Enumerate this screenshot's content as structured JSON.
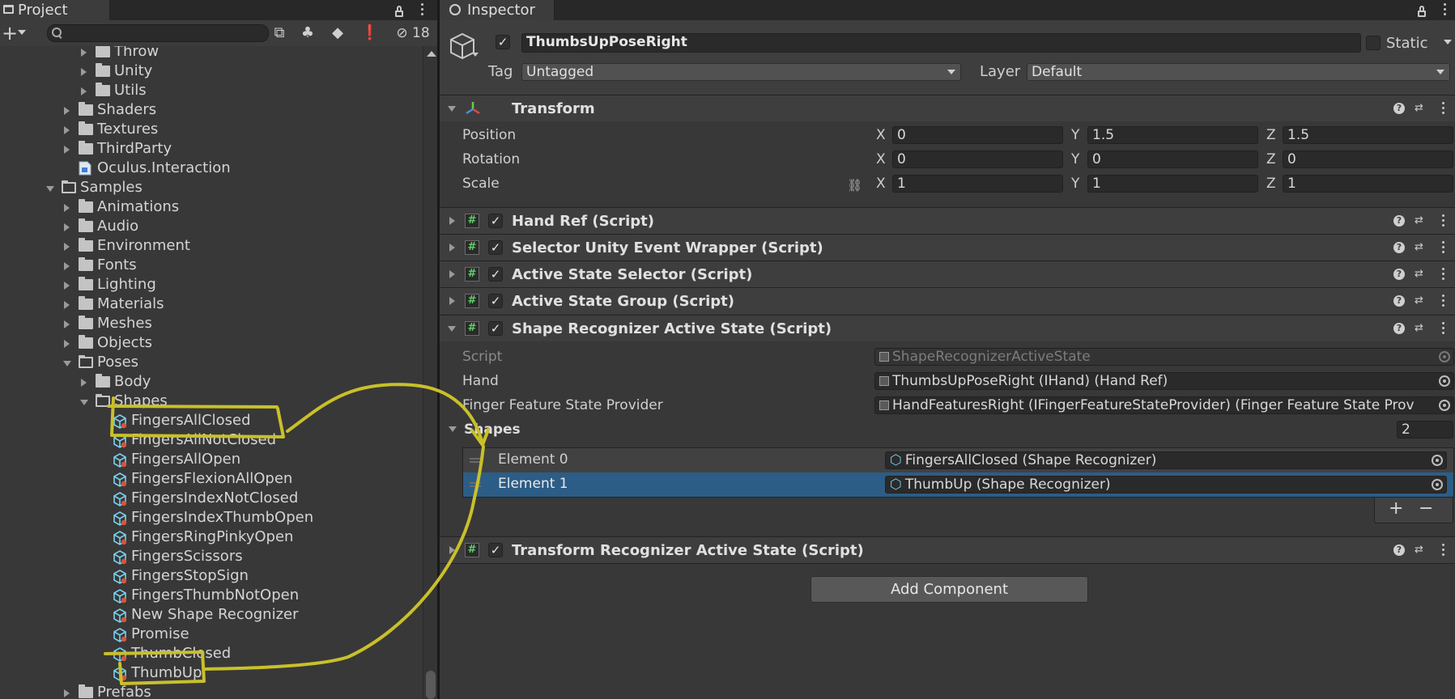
{
  "project_panel": {
    "tab_label": "Project",
    "hidden_count": "18",
    "tree": [
      {
        "label": "Throw",
        "type": "folder",
        "expanded": false,
        "depth": 4,
        "has_children": true
      },
      {
        "label": "Unity",
        "type": "folder",
        "expanded": false,
        "depth": 4,
        "has_children": true
      },
      {
        "label": "Utils",
        "type": "folder",
        "expanded": false,
        "depth": 4,
        "has_children": true
      },
      {
        "label": "Shaders",
        "type": "folder",
        "expanded": false,
        "depth": 3,
        "has_children": true
      },
      {
        "label": "Textures",
        "type": "folder",
        "expanded": false,
        "depth": 3,
        "has_children": true
      },
      {
        "label": "ThirdParty",
        "type": "folder",
        "expanded": false,
        "depth": 3,
        "has_children": true
      },
      {
        "label": "Oculus.Interaction",
        "type": "asmdef",
        "depth": 3,
        "has_children": false
      },
      {
        "label": "Samples",
        "type": "folder",
        "expanded": true,
        "depth": 2,
        "has_children": true
      },
      {
        "label": "Animations",
        "type": "folder",
        "expanded": false,
        "depth": 3,
        "has_children": true
      },
      {
        "label": "Audio",
        "type": "folder",
        "expanded": false,
        "depth": 3,
        "has_children": true
      },
      {
        "label": "Environment",
        "type": "folder",
        "expanded": false,
        "depth": 3,
        "has_children": true
      },
      {
        "label": "Fonts",
        "type": "folder",
        "expanded": false,
        "depth": 3,
        "has_children": true
      },
      {
        "label": "Lighting",
        "type": "folder",
        "expanded": false,
        "depth": 3,
        "has_children": true
      },
      {
        "label": "Materials",
        "type": "folder",
        "expanded": false,
        "depth": 3,
        "has_children": true
      },
      {
        "label": "Meshes",
        "type": "folder",
        "expanded": false,
        "depth": 3,
        "has_children": true
      },
      {
        "label": "Objects",
        "type": "folder",
        "expanded": false,
        "depth": 3,
        "has_children": true
      },
      {
        "label": "Poses",
        "type": "folder",
        "expanded": true,
        "depth": 3,
        "has_children": true
      },
      {
        "label": "Body",
        "type": "folder",
        "expanded": false,
        "depth": 4,
        "has_children": true
      },
      {
        "label": "Shapes",
        "type": "folder",
        "expanded": true,
        "depth": 4,
        "has_children": true
      },
      {
        "label": "FingersAllClosed",
        "type": "asset",
        "depth": 5,
        "has_children": false
      },
      {
        "label": "FingersAllNotClosed",
        "type": "asset",
        "depth": 5,
        "has_children": false
      },
      {
        "label": "FingersAllOpen",
        "type": "asset",
        "depth": 5,
        "has_children": false
      },
      {
        "label": "FingersFlexionAllOpen",
        "type": "asset",
        "depth": 5,
        "has_children": false
      },
      {
        "label": "FingersIndexNotClosed",
        "type": "asset",
        "depth": 5,
        "has_children": false
      },
      {
        "label": "FingersIndexThumbOpen",
        "type": "asset",
        "depth": 5,
        "has_children": false
      },
      {
        "label": "FingersRingPinkyOpen",
        "type": "asset",
        "depth": 5,
        "has_children": false
      },
      {
        "label": "FingersScissors",
        "type": "asset",
        "depth": 5,
        "has_children": false
      },
      {
        "label": "FingersStopSign",
        "type": "asset",
        "depth": 5,
        "has_children": false
      },
      {
        "label": "FingersThumbNotOpen",
        "type": "asset",
        "depth": 5,
        "has_children": false
      },
      {
        "label": "New Shape Recognizer",
        "type": "asset",
        "depth": 5,
        "has_children": false
      },
      {
        "label": "Promise",
        "type": "asset",
        "depth": 5,
        "has_children": false
      },
      {
        "label": "ThumbClosed",
        "type": "asset",
        "depth": 5,
        "has_children": false
      },
      {
        "label": "ThumbUp",
        "type": "asset",
        "depth": 5,
        "has_children": false
      },
      {
        "label": "Prefabs",
        "type": "folder",
        "expanded": false,
        "depth": 3,
        "has_children": true
      }
    ]
  },
  "inspector": {
    "tab_label": "Inspector",
    "object_name": "ThumbsUpPoseRight",
    "static_label": "Static",
    "tag_label": "Tag",
    "tag_value": "Untagged",
    "layer_label": "Layer",
    "layer_value": "Default",
    "transform": {
      "title": "Transform",
      "position_label": "Position",
      "rotation_label": "Rotation",
      "scale_label": "Scale",
      "position": {
        "x": "0",
        "y": "1.5",
        "z": "1.5"
      },
      "rotation": {
        "x": "0",
        "y": "0",
        "z": "0"
      },
      "scale": {
        "x": "1",
        "y": "1",
        "z": "1"
      },
      "axis_x": "X",
      "axis_y": "Y",
      "axis_z": "Z"
    },
    "components": [
      "Hand Ref (Script)",
      "Selector Unity Event Wrapper (Script)",
      "Active State Selector (Script)",
      "Active State Group (Script)",
      "Shape Recognizer Active State (Script)",
      "Transform Recognizer Active State (Script)"
    ],
    "shape_recognizer": {
      "script_label": "Script",
      "script_value": "ShapeRecognizerActiveState",
      "hand_label": "Hand",
      "hand_value": "ThumbsUpPoseRight (IHand) (Hand Ref)",
      "provider_label": "Finger Feature State Provider",
      "provider_value": "HandFeaturesRight (IFingerFeatureStateProvider) (Finger Feature State Prov",
      "shapes_label": "Shapes",
      "shapes_count": "2",
      "elements": [
        {
          "label": "Element 0",
          "value": "FingersAllClosed (Shape Recognizer)"
        },
        {
          "label": "Element 1",
          "value": "ThumbUp (Shape Recognizer)"
        }
      ],
      "plus": "+",
      "minus": "−"
    },
    "add_component_label": "Add Component"
  },
  "colors": {
    "panel_bg": "#383838",
    "header_bg": "#3e3e3e",
    "field_bg": "#2a2a2a",
    "selection": "#2c5d87",
    "annotation": "#c9c02a",
    "script_icon_green": "#5fd06a"
  }
}
